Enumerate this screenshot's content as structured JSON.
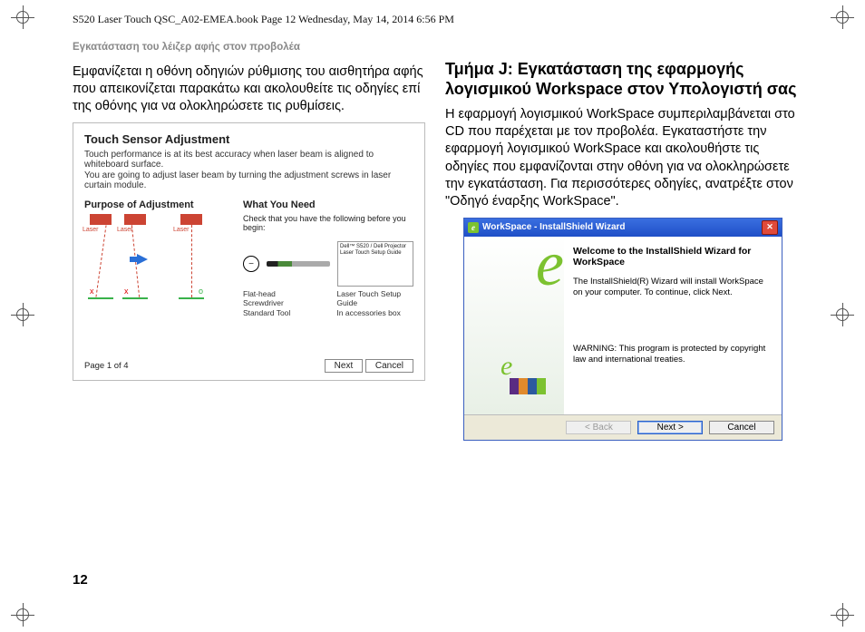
{
  "meta_header": "S520 Laser Touch QSC_A02-EMEA.book  Page 12  Wednesday, May 14, 2014  6:56 PM",
  "running_head": "Εγκατάσταση του λέιζερ αφής στον προβολέα",
  "page_num": "12",
  "col_left": {
    "para": "Εμφανίζεται η οθόνη οδηγιών ρύθμισης του αισθητήρα αφής που απεικονίζεται παρακάτω και ακολουθείτε τις οδηγίες επί της οθόνης για να ολοκληρώσετε τις ρυθμίσεις.",
    "ss": {
      "title": "Touch Sensor Adjustment",
      "line1": "Touch performance is at its best accuracy when laser beam is aligned to whiteboard surface.",
      "line2": "You are going to adjust laser beam by turning the adjustment screws in laser curtain module.",
      "purpose_h": "Purpose of Adjustment",
      "need_h": "What You Need",
      "need_sub": "Check that you have the following before you begin:",
      "laser_label": "Laser",
      "cap_tool1": "Flat-head Screwdriver",
      "cap_tool1b": "Standard Tool",
      "cap_tool2": "Laser Touch Setup Guide",
      "cap_tool2b": "In accessories box",
      "guide_text": "Dell™ S520 / Dell Projector\nLaser Touch\nSetup Guide",
      "footer_page": "Page 1 of 4",
      "btn_next": "Next",
      "btn_cancel": "Cancel"
    }
  },
  "col_right": {
    "heading": "Τμήμα J: Εγκατάσταση της εφαρμογής λογισμικού Workspace στον Υπολογιστή σας",
    "para": "Η εφαρμογή λογισμικού WorkSpace συμπεριλαμβάνεται στο CD που παρέχεται με τον προβολέα. Εγκαταστήστε την εφαρμογή λογισμικού WorkSpace και ακολουθήστε τις οδηγίες που εμφανίζονται στην οθόνη για να ολοκληρώσετε την εγκατάσταση. Για περισσότερες οδηγίες, ανατρέξτε στον \"Οδηγό έναρξης WorkSpace\".",
    "dlg": {
      "title": "WorkSpace - InstallShield Wizard",
      "h": "Welcome to the InstallShield Wizard for WorkSpace",
      "p1": "The InstallShield(R) Wizard will install WorkSpace on your computer. To continue, click Next.",
      "p2": "WARNING: This program is protected by copyright law and international treaties.",
      "btn_back": "< Back",
      "btn_next": "Next >",
      "btn_cancel": "Cancel"
    }
  }
}
